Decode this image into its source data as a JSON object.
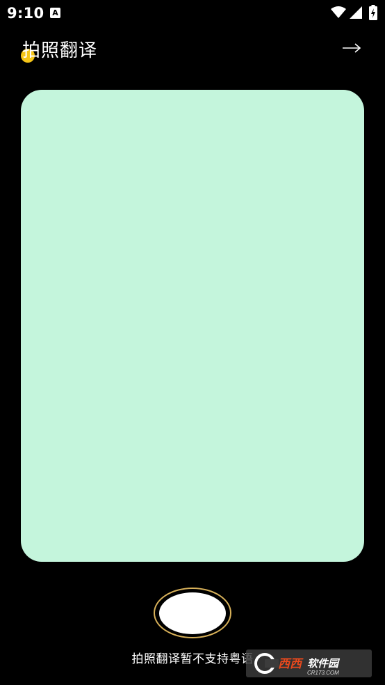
{
  "status_bar": {
    "time": "9:10",
    "notification_icon": "a-badge-icon",
    "notification_letter": "A",
    "wifi_icon": "wifi-icon",
    "signal_icon": "signal-icon",
    "battery_icon": "battery-charging-icon"
  },
  "header": {
    "title": "拍照翻译",
    "arrow_icon": "arrow-right-icon",
    "arrow_glyph": "→",
    "dot_color": "#f5c518"
  },
  "preview": {
    "background_color": "#c4f5dc"
  },
  "shutter": {
    "ring_color": "#d9b25a",
    "fill_color": "#ffffff"
  },
  "note": {
    "text": "拍照翻译暂不支持粤语"
  },
  "watermark": {
    "brand_text": "西西软件园",
    "url_text": "CR173.COM"
  },
  "colors": {
    "background": "#000000",
    "accent": "#f5c518",
    "preview": "#c4f5dc"
  }
}
